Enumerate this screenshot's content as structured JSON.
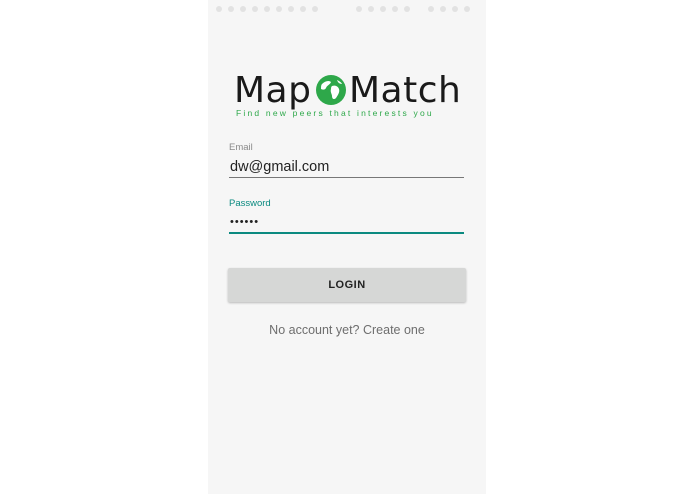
{
  "app": {
    "logo_left": "Map",
    "logo_right": "Match",
    "tagline": "Find new peers that interests you",
    "logo_icon": "globe-icon"
  },
  "form": {
    "email_label": "Email",
    "email_value": "dw@gmail.com",
    "password_label": "Password",
    "password_value": "••••••"
  },
  "actions": {
    "login_label": "LOGIN",
    "signup_prompt": "No account yet? Create one"
  },
  "colors": {
    "accent": "#0b8a80",
    "brand_green": "#2ea84a",
    "screen_bg": "#f6f6f6",
    "button_bg": "#d6d7d6"
  }
}
